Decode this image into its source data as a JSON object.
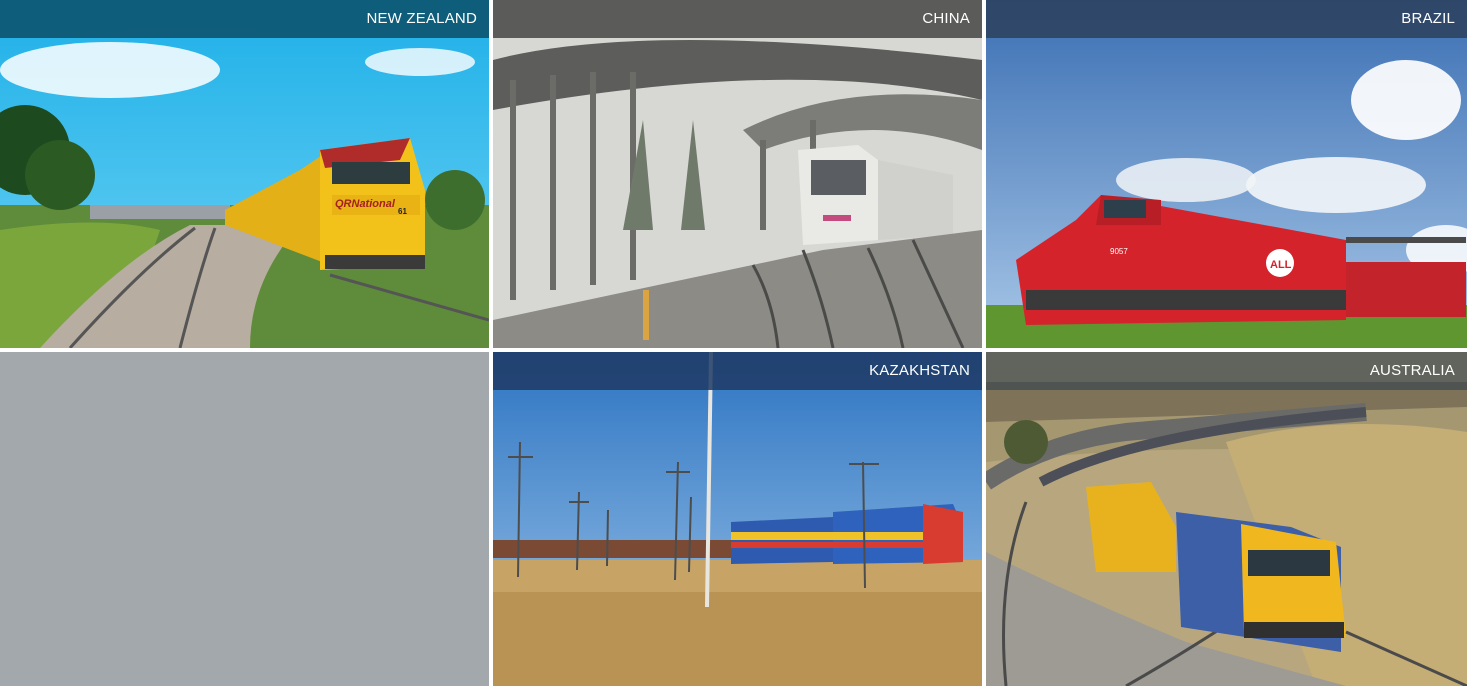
{
  "tiles": [
    {
      "id": "new-zealand",
      "label": "NEW ZEALAND",
      "caption_color": "#0d5670"
    },
    {
      "id": "china",
      "label": "CHINA",
      "caption_color": "#3a3a3a"
    },
    {
      "id": "brazil",
      "label": "BRAZIL",
      "caption_color": "#2c3e58"
    },
    {
      "id": "kazakhstan",
      "label": "KAZAKHSTAN",
      "caption_color": "#1e3a64"
    },
    {
      "id": "australia",
      "label": "AUSTRALIA",
      "caption_color": "#3c4750"
    }
  ],
  "locomotive_markings": {
    "new_zealand": {
      "brand": "QRNational",
      "number": "61"
    },
    "brazil": {
      "number": "9057",
      "logo": "ALL"
    }
  },
  "colors": {
    "placeholder_panel": "#a3a8ad",
    "background": "#ffffff"
  }
}
